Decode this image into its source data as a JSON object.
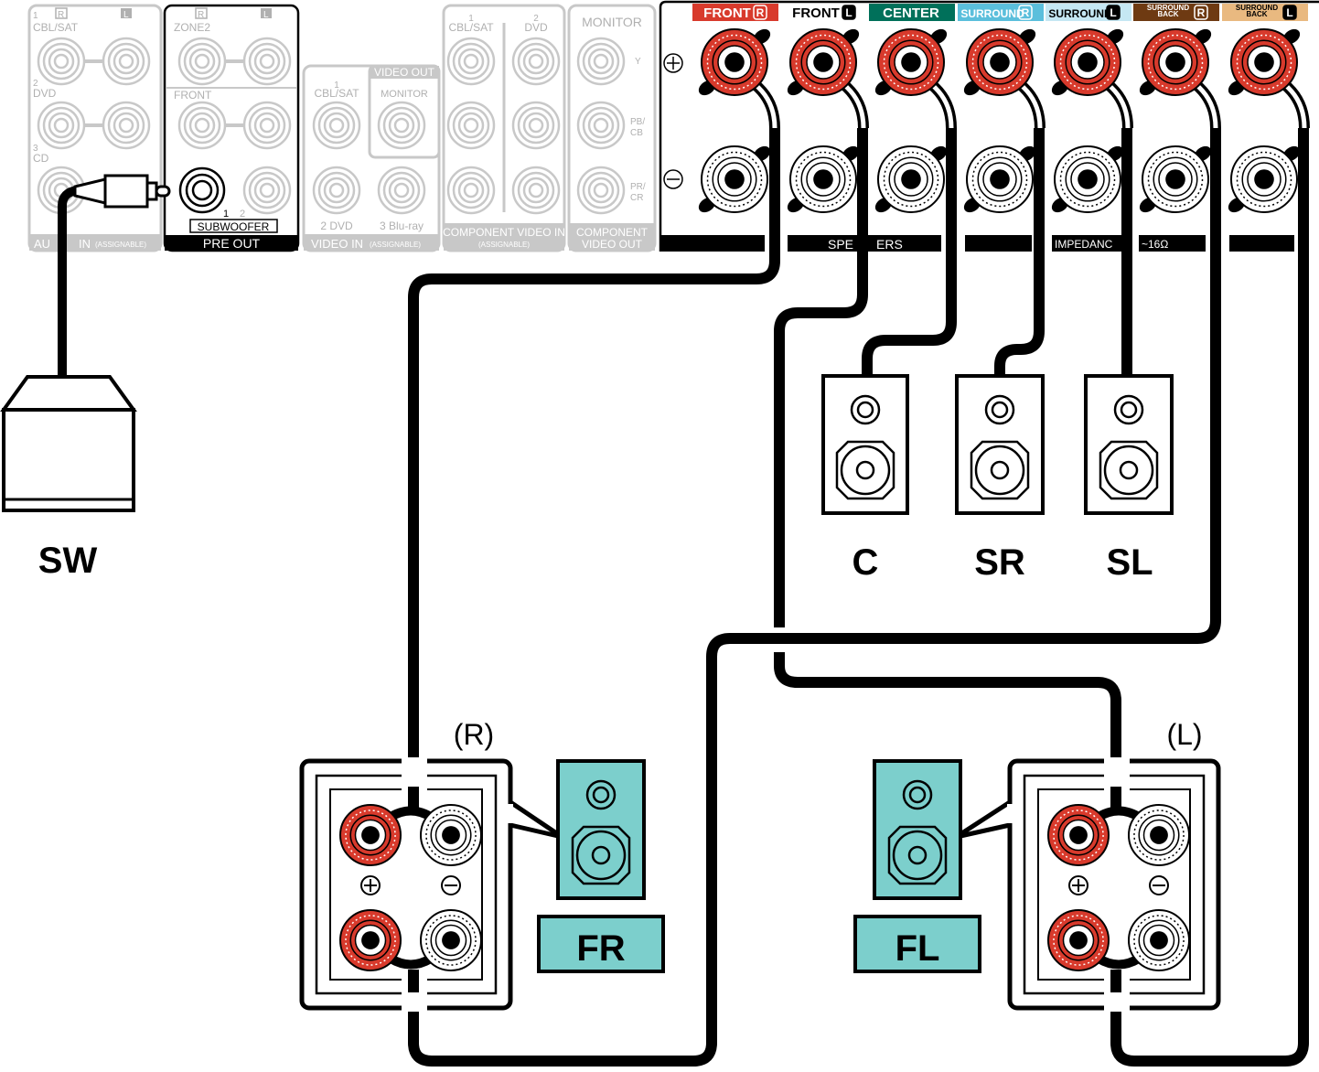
{
  "input_panel": {
    "audio_in": {
      "r": "R",
      "l": "L",
      "inputs": [
        "1",
        "CBL/SAT",
        "2",
        "DVD",
        "3",
        "CD"
      ],
      "footer_a": "AU",
      "footer_b": "IN",
      "assignable": "(ASSIGNABLE)"
    },
    "pre_out": {
      "r": "R",
      "l": "L",
      "zone2": "ZONE2",
      "front": "FRONT",
      "sub_1": "1",
      "sub_2": "2",
      "subwoofer": "SUBWOOFER",
      "footer": "PRE OUT"
    },
    "video_in": {
      "num1": "1",
      "cbl_sat": "CBL/SAT",
      "video_out": "VIDEO OUT",
      "monitor": "MONITOR",
      "dvd": "2 DVD",
      "bluray": "3 Blu-ray",
      "footer": "VIDEO IN",
      "assignable": "(ASSIGNABLE)"
    },
    "component_in": {
      "num1": "1",
      "cbl_sat": "CBL/SAT",
      "num2": "2",
      "dvd": "DVD",
      "footer": "COMPONENT VIDEO IN",
      "assignable": "(ASSIGNABLE)"
    },
    "component_out": {
      "monitor": "MONITOR",
      "y": "Y",
      "pb": "PB/",
      "cb": "CB",
      "pr": "PR/",
      "cr": "CR",
      "footer_1": "COMPONENT",
      "footer_2": "VIDEO OUT"
    }
  },
  "speaker_panel": {
    "plus": "+",
    "minus": "−",
    "channels": [
      {
        "label": "FRONT",
        "side": "R",
        "bg": "#d83a2c",
        "fg": "#ffffff"
      },
      {
        "label": "FRONT",
        "side": "L",
        "bg": "#ffffff",
        "fg": "#000000"
      },
      {
        "label": "CENTER",
        "side": "",
        "bg": "#00705a",
        "fg": "#ffffff"
      },
      {
        "label": "SURROUND",
        "side": "R",
        "bg": "#5bbfdc",
        "fg": "#ffffff"
      },
      {
        "label": "SURROUND",
        "side": "L",
        "bg": "#c5e7f3",
        "fg": "#000000"
      },
      {
        "label": "SURROUND BACK",
        "side": "R",
        "bg": "#6e3a12",
        "fg": "#ffffff"
      },
      {
        "label": "SURROUND BACK",
        "side": "L",
        "bg": "#e9b980",
        "fg": "#000000"
      }
    ],
    "footer_speakers_a": "SPE",
    "footer_speakers_b": "ERS",
    "footer_impedance": "IMPEDANC",
    "footer_ohm": "~16Ω"
  },
  "speakers": {
    "sw": "SW",
    "c": "C",
    "sr": "SR",
    "sl": "SL",
    "fr": "FR",
    "fl": "FL",
    "fr_side": "(R)",
    "fl_side": "(L)",
    "front_color": "#7ccfcc",
    "terminal_red": "#d83a2c"
  }
}
